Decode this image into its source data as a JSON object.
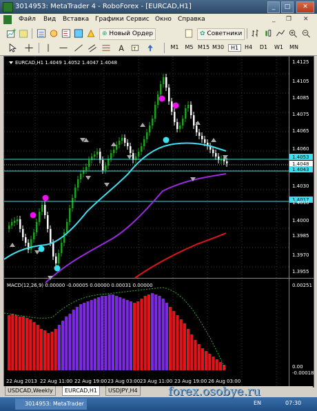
{
  "window": {
    "title": "3014953: MetaTrader 4 - RoboForex - [EURCAD,H1]"
  },
  "menu": [
    "Файл",
    "Вид",
    "Вставка",
    "Графики",
    "Сервис",
    "Окно",
    "Справка"
  ],
  "toolbar": {
    "new_order": "Новый Ордер",
    "advisors": "Советники"
  },
  "timeframes": [
    "M1",
    "M5",
    "M15",
    "M30",
    "H1",
    "H4",
    "D1",
    "W1",
    "MN"
  ],
  "timeframe_selected": "H1",
  "chart": {
    "header": "EURCAD,H1  1.4049 1.4052 1.4047 1.4048",
    "price_labels": [
      "1.4125",
      "1.4105",
      "1.4085",
      "1.4075",
      "1.4065",
      "1.4060",
      "1.4053",
      "1.4048",
      "1.4043",
      "1.4030",
      "1.4017",
      "1.4010",
      "1.4000",
      "1.3985",
      "1.3970",
      "1.3955"
    ],
    "macd_header": "MACD(12,26,9) 0.00000 -0.00005 0.00000 0.00031 0.00000",
    "macd_labels": [
      "0.00251",
      "0.00",
      "-0.00018"
    ],
    "time_labels": [
      "22 Aug 2013",
      "22 Aug 11:00",
      "22 Aug 19:00",
      "23 Aug 03:00",
      "23 Aug 11:00",
      "23 Aug 19:00",
      "26 Aug 03:00"
    ],
    "colors": {
      "candle_up": "#1fa01f",
      "candle_down": "#ffffff",
      "ma_fast": "#3fe0f0",
      "ma_mid": "#9a2be0",
      "ma_slow": "#e0141b",
      "dot_magenta": "#f010f0",
      "dot_cyan": "#3fe0f0",
      "macd_red": "#e0141b",
      "macd_purple": "#7a2be0"
    }
  },
  "tabs": [
    "USDCAD,Weekly",
    "EURCAD,H1",
    "USDJPY,H4"
  ],
  "active_tab": "EURCAD,H1",
  "taskbar": {
    "item": "3014953: MetaTrader",
    "lang": "EN",
    "clock": "07:30"
  },
  "watermark": "forex.osobye.ru"
}
